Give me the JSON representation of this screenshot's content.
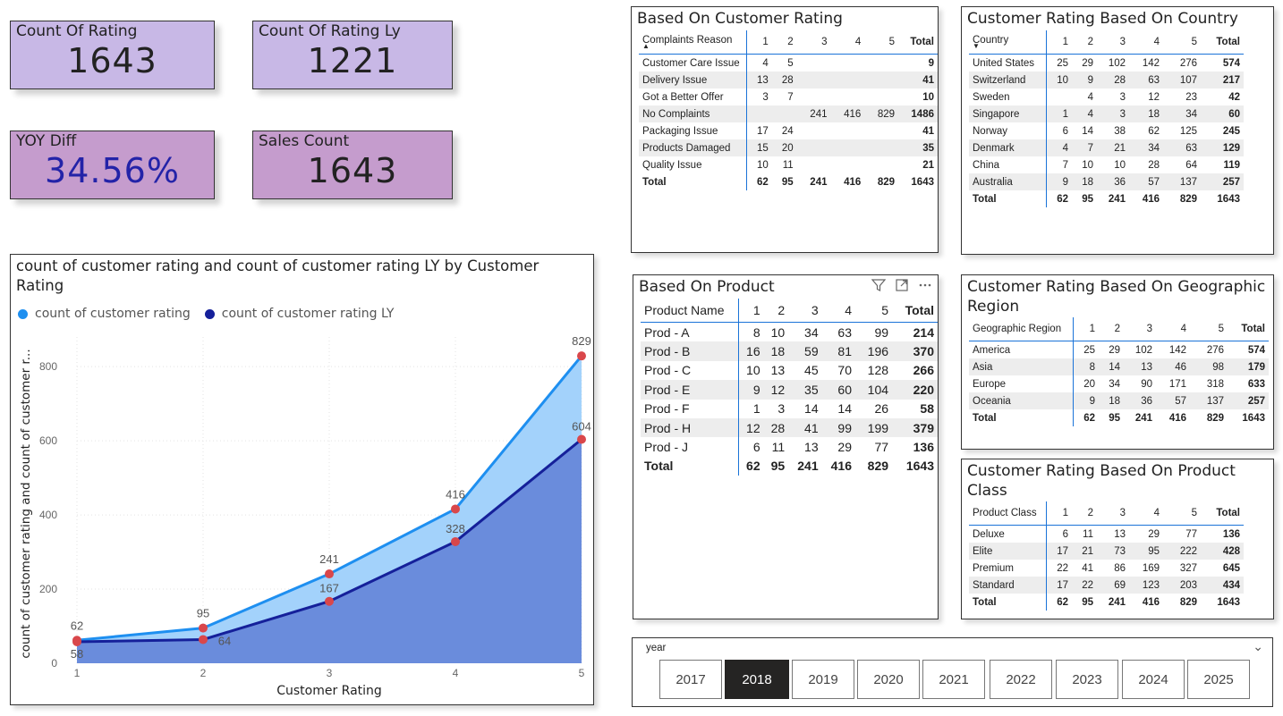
{
  "kpis": {
    "count_rating": {
      "label": "Count Of Rating",
      "value": "1643"
    },
    "count_rating_ly": {
      "label": "Count Of Rating Ly",
      "value": "1221"
    },
    "yoy_diff": {
      "label": "YOY Diff",
      "value": "34.56%"
    },
    "sales_count": {
      "label": "Sales Count",
      "value": "1643"
    }
  },
  "colors": {
    "current": "#1e8ff0",
    "last_year": "#15209a",
    "area_current": "#a3d2fb",
    "area_ly": "#6a8cdc",
    "marker": "#d9474b"
  },
  "chart_data": {
    "type": "area",
    "title": "count of customer rating and count of customer rating LY by Customer Rating",
    "xlabel": "Customer Rating",
    "ylabel": "count of customer rating and count of customer r...",
    "x": [
      1,
      2,
      3,
      4,
      5
    ],
    "ylim": [
      0,
      880
    ],
    "yticks": [
      0,
      200,
      400,
      600,
      800
    ],
    "series": [
      {
        "name": "count of customer rating",
        "values": [
          62,
          95,
          241,
          416,
          829
        ]
      },
      {
        "name": "count of customer rating LY",
        "values": [
          58,
          64,
          167,
          328,
          604
        ]
      }
    ]
  },
  "complaints": {
    "title": "Based On Customer Rating",
    "headers": [
      "Complaints Reason",
      "1",
      "2",
      "3",
      "4",
      "5",
      "Total"
    ],
    "rows": [
      [
        "Customer Care Issue",
        "4",
        "5",
        "",
        "",
        "",
        "9"
      ],
      [
        "Delivery Issue",
        "13",
        "28",
        "",
        "",
        "",
        "41"
      ],
      [
        "Got a Better Offer",
        "3",
        "7",
        "",
        "",
        "",
        "10"
      ],
      [
        "No Complaints",
        "",
        "",
        "241",
        "416",
        "829",
        "1486"
      ],
      [
        "Packaging Issue",
        "17",
        "24",
        "",
        "",
        "",
        "41"
      ],
      [
        "Products Damaged",
        "15",
        "20",
        "",
        "",
        "",
        "35"
      ],
      [
        "Quality Issue",
        "10",
        "11",
        "",
        "",
        "",
        "21"
      ]
    ],
    "total": [
      "Total",
      "62",
      "95",
      "241",
      "416",
      "829",
      "1643"
    ]
  },
  "country": {
    "title": "Customer Rating Based On Country",
    "headers": [
      "Country",
      "1",
      "2",
      "3",
      "4",
      "5",
      "Total"
    ],
    "rows": [
      [
        "United States",
        "25",
        "29",
        "102",
        "142",
        "276",
        "574"
      ],
      [
        "Switzerland",
        "10",
        "9",
        "28",
        "63",
        "107",
        "217"
      ],
      [
        "Sweden",
        "",
        "4",
        "3",
        "12",
        "23",
        "42"
      ],
      [
        "Singapore",
        "1",
        "4",
        "3",
        "18",
        "34",
        "60"
      ],
      [
        "Norway",
        "6",
        "14",
        "38",
        "62",
        "125",
        "245"
      ],
      [
        "Denmark",
        "4",
        "7",
        "21",
        "34",
        "63",
        "129"
      ],
      [
        "China",
        "7",
        "10",
        "10",
        "28",
        "64",
        "119"
      ],
      [
        "Australia",
        "9",
        "18",
        "36",
        "57",
        "137",
        "257"
      ]
    ],
    "total": [
      "Total",
      "62",
      "95",
      "241",
      "416",
      "829",
      "1643"
    ]
  },
  "product": {
    "title": "Based On Product",
    "headers": [
      "Product Name",
      "1",
      "2",
      "3",
      "4",
      "5",
      "Total"
    ],
    "rows": [
      [
        "Prod - A",
        "8",
        "10",
        "34",
        "63",
        "99",
        "214"
      ],
      [
        "Prod - B",
        "16",
        "18",
        "59",
        "81",
        "196",
        "370"
      ],
      [
        "Prod - C",
        "10",
        "13",
        "45",
        "70",
        "128",
        "266"
      ],
      [
        "Prod - E",
        "9",
        "12",
        "35",
        "60",
        "104",
        "220"
      ],
      [
        "Prod - F",
        "1",
        "3",
        "14",
        "14",
        "26",
        "58"
      ],
      [
        "Prod - H",
        "12",
        "28",
        "41",
        "99",
        "199",
        "379"
      ],
      [
        "Prod - J",
        "6",
        "11",
        "13",
        "29",
        "77",
        "136"
      ]
    ],
    "total": [
      "Total",
      "62",
      "95",
      "241",
      "416",
      "829",
      "1643"
    ]
  },
  "region": {
    "title": "Customer Rating Based On Geographic Region",
    "headers": [
      "Geographic Region",
      "1",
      "2",
      "3",
      "4",
      "5",
      "Total"
    ],
    "rows": [
      [
        "America",
        "25",
        "29",
        "102",
        "142",
        "276",
        "574"
      ],
      [
        "Asia",
        "8",
        "14",
        "13",
        "46",
        "98",
        "179"
      ],
      [
        "Europe",
        "20",
        "34",
        "90",
        "171",
        "318",
        "633"
      ],
      [
        "Oceania",
        "9",
        "18",
        "36",
        "57",
        "137",
        "257"
      ]
    ],
    "total": [
      "Total",
      "62",
      "95",
      "241",
      "416",
      "829",
      "1643"
    ]
  },
  "product_class": {
    "title": "Customer Rating Based On Product Class",
    "headers": [
      "Product Class",
      "1",
      "2",
      "3",
      "4",
      "5",
      "Total"
    ],
    "rows": [
      [
        "Deluxe",
        "6",
        "11",
        "13",
        "29",
        "77",
        "136"
      ],
      [
        "Elite",
        "17",
        "21",
        "73",
        "95",
        "222",
        "428"
      ],
      [
        "Premium",
        "22",
        "41",
        "86",
        "169",
        "327",
        "645"
      ],
      [
        "Standard",
        "17",
        "22",
        "69",
        "123",
        "203",
        "434"
      ]
    ],
    "total": [
      "Total",
      "62",
      "95",
      "241",
      "416",
      "829",
      "1643"
    ]
  },
  "year_slicer": {
    "title": "year",
    "options": [
      "2017",
      "2018",
      "2019",
      "2020",
      "2021",
      "2022",
      "2023",
      "2024",
      "2025"
    ],
    "selected": "2018"
  },
  "visual_icons": {
    "filter": "filter-icon",
    "focus": "focus-mode-icon",
    "more": "more-options-icon"
  }
}
